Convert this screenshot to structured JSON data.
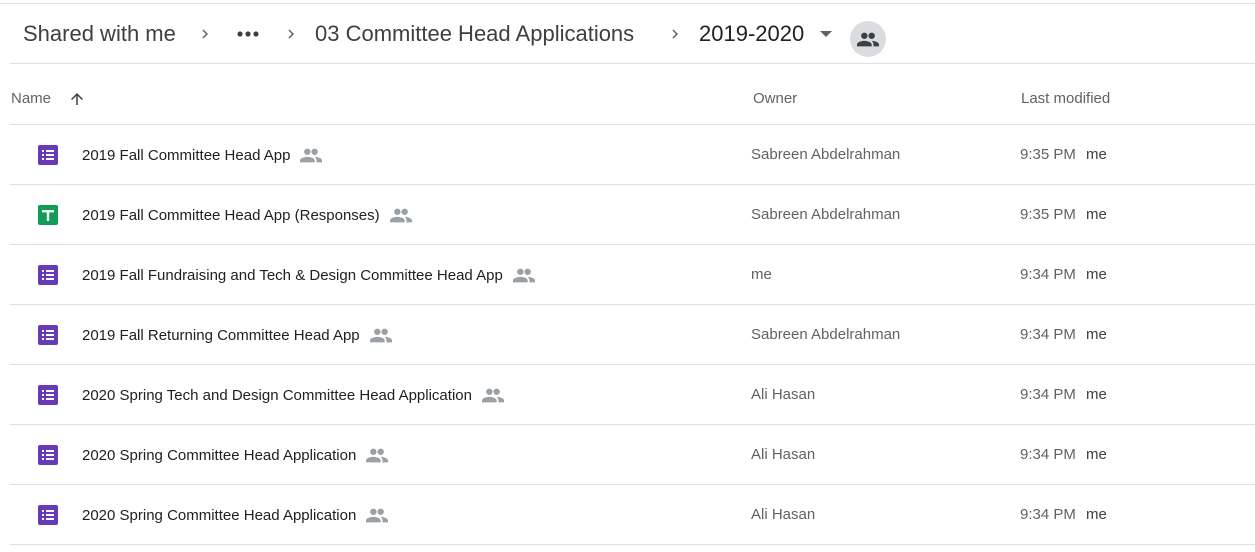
{
  "breadcrumb": {
    "root": "Shared with me",
    "parent": "03 Committee Head Applications",
    "current": "2019-2020"
  },
  "icons": {
    "chevron": "chevron-right-icon",
    "more": "more-horiz-icon",
    "dropdown": "arrow-drop-down-icon",
    "shared": "shared-folder-icon",
    "sort": "arrow-upward-icon",
    "people": "people-icon"
  },
  "colors": {
    "forms": "#673ab7",
    "sheets": "#0f9d58",
    "text_primary": "#202124",
    "text_secondary": "#5f6368",
    "divider": "#e0e0e0"
  },
  "table": {
    "columns": {
      "name": "Name",
      "owner": "Owner",
      "modified": "Last modified"
    },
    "rows": [
      {
        "type": "forms",
        "name": "2019 Fall Committee Head App",
        "owner": "Sabreen Abdelrahman",
        "modified": "9:35 PM",
        "modified_by": "me"
      },
      {
        "type": "sheets",
        "name": "2019 Fall Committee Head App (Responses)",
        "owner": "Sabreen Abdelrahman",
        "modified": "9:35 PM",
        "modified_by": "me"
      },
      {
        "type": "forms",
        "name": "2019 Fall Fundraising and Tech & Design Committee Head App",
        "owner": "me",
        "modified": "9:34 PM",
        "modified_by": "me"
      },
      {
        "type": "forms",
        "name": "2019 Fall Returning Committee Head App",
        "owner": "Sabreen Abdelrahman",
        "modified": "9:34 PM",
        "modified_by": "me"
      },
      {
        "type": "forms",
        "name": "2020 Spring Tech and Design Committee Head Application",
        "owner": "Ali Hasan",
        "modified": "9:34 PM",
        "modified_by": "me"
      },
      {
        "type": "forms",
        "name": "2020 Spring Committee Head Application",
        "owner": "Ali Hasan",
        "modified": "9:34 PM",
        "modified_by": "me"
      },
      {
        "type": "forms",
        "name": "2020 Spring Committee Head Application",
        "owner": "Ali Hasan",
        "modified": "9:34 PM",
        "modified_by": "me"
      }
    ]
  }
}
